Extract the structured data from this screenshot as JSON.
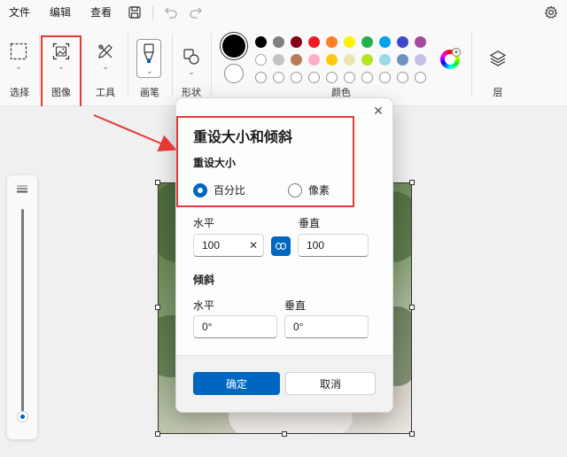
{
  "menu": {
    "file": "文件",
    "edit": "编辑",
    "view": "查看"
  },
  "ribbon": {
    "select_label": "选择",
    "image_label": "图像",
    "tools_label": "工具",
    "brush_label": "画笔",
    "shapes_label": "形状",
    "colors_label": "颜色",
    "layers_label": "层"
  },
  "palette": {
    "row1": [
      "#000000",
      "#7f7f7f",
      "#880015",
      "#ed1c24",
      "#ff7f27",
      "#fff200",
      "#22b14c",
      "#00a2e8",
      "#3f48cc",
      "#a349a4"
    ],
    "row2": [
      "#ffffff",
      "#c3c3c3",
      "#b97a57",
      "#ffaec9",
      "#ffc90e",
      "#efe4b0",
      "#b5e61d",
      "#99d9ea",
      "#7092be",
      "#c8bfe7"
    ],
    "primary": "#000000",
    "secondary": "#ffffff"
  },
  "zoom": {
    "level_fraction": 0.02
  },
  "dialog": {
    "title": "重设大小和倾斜",
    "resize_label": "重设大小",
    "option_percent": "百分比",
    "option_pixels": "像素",
    "selected_option": "percent",
    "horizontal_label": "水平",
    "vertical_label": "垂直",
    "horizontal_value": "100",
    "vertical_value": "100",
    "skew_label": "倾斜",
    "skew_horizontal_label": "水平",
    "skew_vertical_label": "垂直",
    "skew_horizontal_value": "0°",
    "skew_vertical_value": "0°",
    "ok": "确定",
    "cancel": "取消"
  },
  "colors": {
    "accent": "#0067c0",
    "highlight": "#e53935"
  }
}
